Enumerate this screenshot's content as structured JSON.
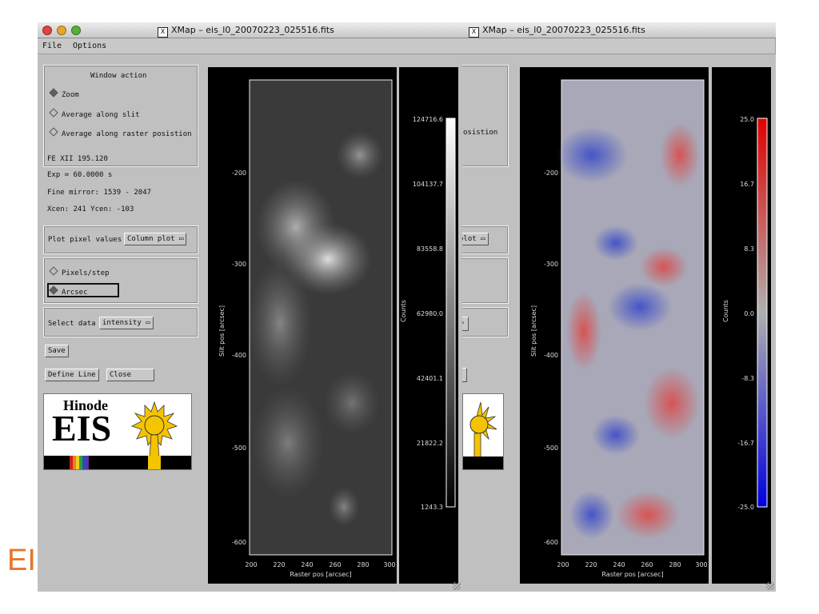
{
  "windows": [
    {
      "title": "XMap – eis_l0_20070223_025516.fits",
      "menu": [
        "File",
        "Options"
      ],
      "window_action": {
        "heading": "Window action",
        "options": [
          "Zoom",
          "Average along slit",
          "Average along raster posistion"
        ],
        "selected": "Zoom"
      },
      "info": [
        "FE XII 195.120",
        "Exp = 60.0000 s",
        "Fine mirror: 1539 - 2047",
        "Xcen:  241 Ycen: -103"
      ],
      "plot_pixel": {
        "label": "Plot pixel values",
        "value": "Column plot"
      },
      "units": {
        "options": [
          "Pixels/step",
          "Arcsec"
        ],
        "selected": "Arcsec"
      },
      "select_data": {
        "label": "Select data",
        "value": "intensity"
      },
      "buttons": {
        "save": "Save",
        "define_line": "Define Line",
        "close": "Close"
      },
      "logo": {
        "line1": "Hinode",
        "line2": "EIS"
      },
      "image": {
        "ylabel": "Slit pos [arcsec]",
        "xlabel": "Raster pos [arcsec]",
        "yticks": [
          "-200",
          "-300",
          "-400",
          "-500",
          "-600"
        ],
        "xticks": [
          "200",
          "220",
          "240",
          "260",
          "280",
          "300"
        ]
      },
      "colorbar": {
        "label": "Counts",
        "ticks": [
          "124716.6",
          "104137.7",
          "83558.8",
          "62980.0",
          "42401.1",
          "21822.2",
          "1243.3"
        ],
        "colormap": "grayscale"
      }
    },
    {
      "title": "XMap – eis_l0_20070223_025516.fits",
      "partial_labels": {
        "window_action_tail": "osistion",
        "plot_pixel_tail": "plot"
      },
      "image": {
        "ylabel": "Slit pos [arcsec]",
        "xlabel": "Raster pos [arcsec]",
        "yticks": [
          "-200",
          "-300",
          "-400",
          "-500",
          "-600"
        ],
        "xticks": [
          "200",
          "220",
          "240",
          "260",
          "280",
          "300"
        ]
      },
      "colorbar": {
        "label": "Counts",
        "ticks": [
          "25.0",
          "16.7",
          "8.3",
          "0.0",
          "-8.3",
          "-16.7",
          "-25.0"
        ],
        "colormap": "blue-white-red"
      }
    }
  ],
  "overlay_text": "EI",
  "colors": {
    "panel": "#c0c0c0",
    "menubar": "#c8c8c8",
    "plot_bg": "#000000",
    "logo_sun": "#f5c400",
    "overlay": "#e8742a"
  }
}
